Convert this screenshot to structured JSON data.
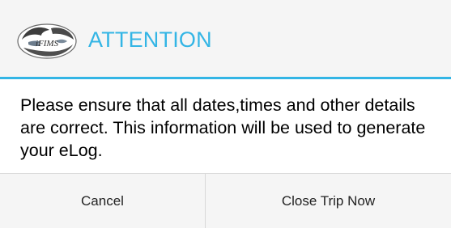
{
  "dialog": {
    "title": "ATTENTION",
    "logo_icon": "ifims-logo-icon",
    "logo_text": "iFIMS",
    "message": "Please ensure that all dates,times and other details are correct. This information will be used to generate your eLog.",
    "accent_color": "#33b5e5",
    "buttons": {
      "cancel_label": "Cancel",
      "close_trip_label": "Close Trip Now"
    }
  }
}
